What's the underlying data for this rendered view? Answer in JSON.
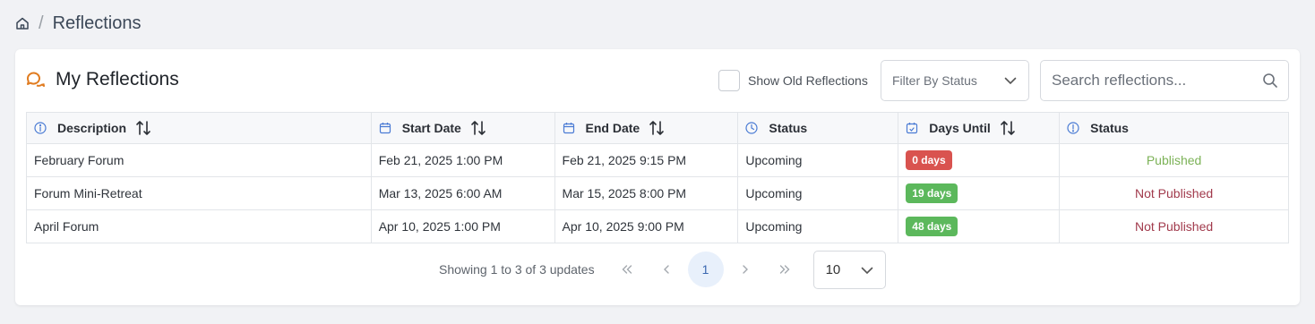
{
  "breadcrumb": {
    "separator": "/",
    "title": "Reflections",
    "home_icon": "home-icon"
  },
  "card": {
    "title": "My Reflections",
    "title_icon": "chat-bubbles-icon",
    "old_toggle_label": "Show Old Reflections",
    "filter_placeholder": "Filter By Status",
    "search_placeholder": "Search reflections..."
  },
  "table": {
    "columns": [
      {
        "label": "Description",
        "icon": "info-icon",
        "sortable": true
      },
      {
        "label": "Start Date",
        "icon": "calendar-icon",
        "sortable": true
      },
      {
        "label": "End Date",
        "icon": "calendar-icon",
        "sortable": true
      },
      {
        "label": "Status",
        "icon": "clock-icon",
        "sortable": false
      },
      {
        "label": "Days Until",
        "icon": "calendar-check-icon",
        "sortable": true
      },
      {
        "label": "Status",
        "icon": "alert-icon",
        "sortable": false
      }
    ],
    "rows": [
      {
        "description": "February Forum",
        "start": "Feb 21, 2025 1:00 PM",
        "end": "Feb 21, 2025 9:15 PM",
        "status": "Upcoming",
        "days": "0 days",
        "days_color": "#d9534f",
        "published": "Published",
        "published_color": "#7cb257"
      },
      {
        "description": "Forum Mini-Retreat",
        "start": "Mar 13, 2025 6:00 AM",
        "end": "Mar 15, 2025 8:00 PM",
        "status": "Upcoming",
        "days": "19 days",
        "days_color": "#5cb85c",
        "published": "Not Published",
        "published_color": "#a13a4c"
      },
      {
        "description": "April Forum",
        "start": "Apr 10, 2025 1:00 PM",
        "end": "Apr 10, 2025 9:00 PM",
        "status": "Upcoming",
        "days": "48 days",
        "days_color": "#5cb85c",
        "published": "Not Published",
        "published_color": "#a13a4c"
      }
    ]
  },
  "pagination": {
    "info": "Showing 1 to 3 of 3 updates",
    "first": "«",
    "prev": "‹",
    "current_page": "1",
    "next": "›",
    "last": "»",
    "page_size": "10"
  },
  "colors": {
    "accent": "#e07b1f",
    "header_icon": "#4a7bd4",
    "active_page_bg": "#e8f0fb"
  }
}
